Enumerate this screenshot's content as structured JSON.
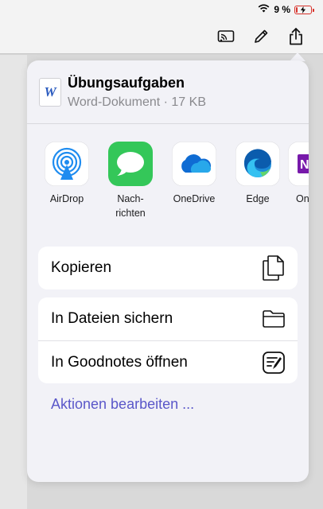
{
  "status_bar": {
    "battery_percent": "9 %",
    "battery_level": 0.09,
    "wifi_icon": "wifi-icon",
    "battery_color": "#d8312a"
  },
  "toolbar": {
    "icons": [
      "cast-icon",
      "pencil-icon",
      "share-icon"
    ]
  },
  "share_sheet": {
    "file": {
      "name": "Übungsaufgaben",
      "subtitle": "Word-Dokument · 17 KB",
      "icon_letter": "W"
    },
    "apps": [
      {
        "label": "AirDrop",
        "icon": "airdrop-icon"
      },
      {
        "label": "Nach-\nrichten",
        "icon": "messages-icon"
      },
      {
        "label": "OneDrive",
        "icon": "onedrive-icon"
      },
      {
        "label": "Edge",
        "icon": "edge-icon"
      },
      {
        "label": "On",
        "icon": "onenote-icon"
      }
    ],
    "actions_group1": [
      {
        "label": "Kopieren",
        "icon": "copy-icon"
      }
    ],
    "actions_group2": [
      {
        "label": "In Dateien sichern",
        "icon": "folder-icon"
      },
      {
        "label": "In Goodnotes öffnen",
        "icon": "goodnotes-icon"
      }
    ],
    "edit_actions_label": "Aktionen bearbeiten ...",
    "colors": {
      "accent": "#5a57c9",
      "messages_green": "#34c759",
      "airdrop_blue": "#1e8cf0",
      "onedrive_blue": "#0f6cd3",
      "onenote_purple": "#7719aa"
    }
  }
}
